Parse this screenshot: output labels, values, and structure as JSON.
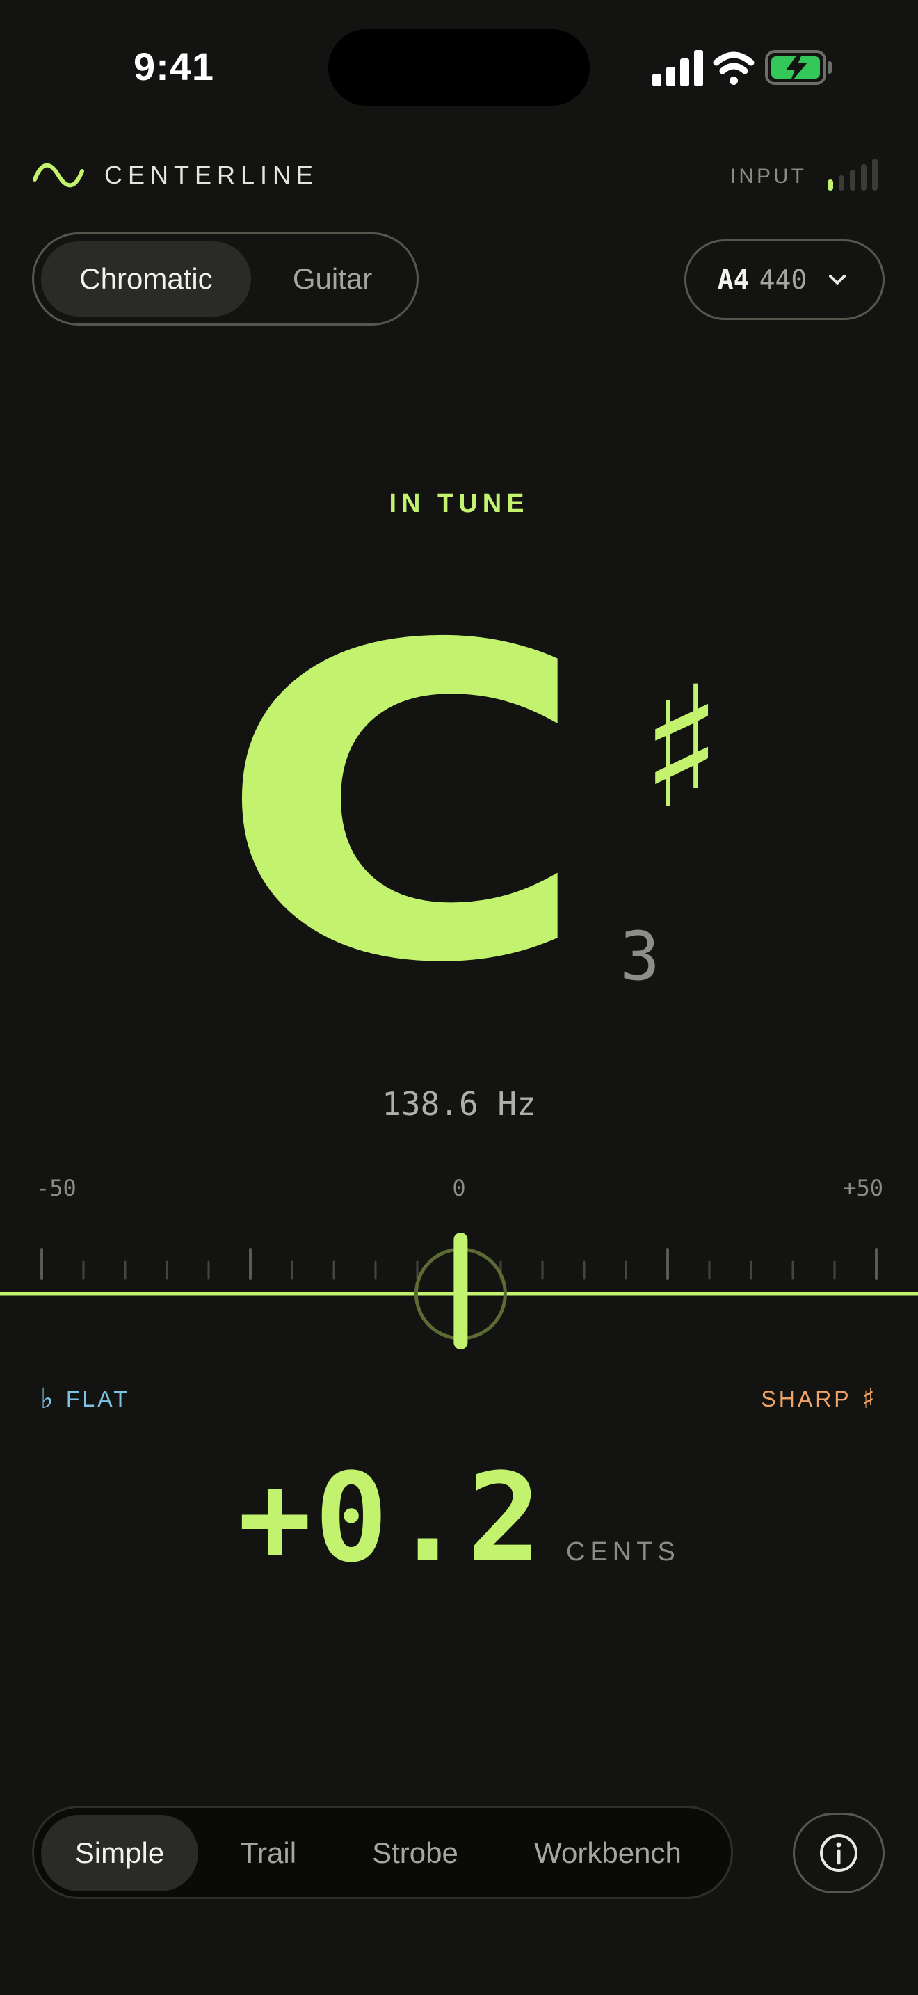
{
  "status_bar": {
    "time": "9:41"
  },
  "header": {
    "brand": "CENTERLINE",
    "brand_icon": "sine-wave-icon",
    "input_label": "INPUT",
    "input_level": 0.2
  },
  "mode": {
    "options": [
      "Chromatic",
      "Guitar"
    ],
    "selected": "Chromatic"
  },
  "reference": {
    "note": "A4",
    "frequency": "440",
    "icon": "chevron-down-icon"
  },
  "tuner": {
    "status": "IN TUNE",
    "note": "C",
    "accidental": "♯",
    "octave": "3",
    "frequency": "138.6 Hz",
    "scale_min": "-50",
    "scale_zero": "0",
    "scale_max": "+50",
    "flat_glyph": "♭",
    "flat_label": "FLAT",
    "sharp_label": "SHARP",
    "sharp_glyph": "♯",
    "cents": "+0.2",
    "cents_value": 0.2,
    "cents_unit": "CENTS"
  },
  "views": {
    "options": [
      "Simple",
      "Trail",
      "Strobe",
      "Workbench"
    ],
    "selected": "Simple",
    "info_icon": "info-icon"
  },
  "colors": {
    "background": "#131412",
    "accent": "#c2f26e",
    "flat": "#7ec3e6",
    "sharp": "#f0a366"
  }
}
